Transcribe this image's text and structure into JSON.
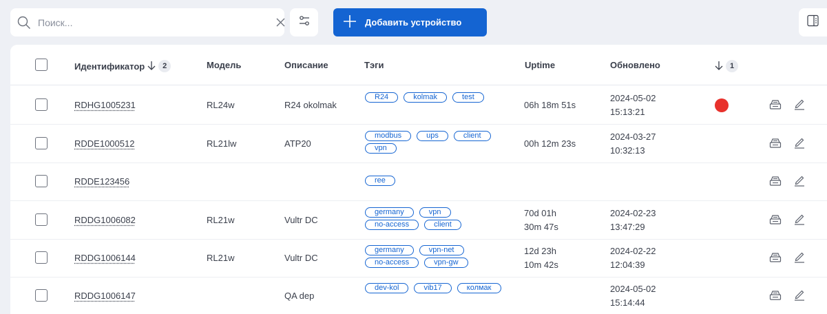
{
  "toolbar": {
    "search_placeholder": "Поиск...",
    "add_label": "Добавить устройство"
  },
  "table": {
    "headers": {
      "id": "Идентификатор",
      "id_sort_index": "2",
      "model": "Модель",
      "description": "Описание",
      "tags": "Тэги",
      "uptime": "Uptime",
      "updated": "Обновлено",
      "status_sort_index": "1"
    },
    "rows": [
      {
        "id": "RDHG1005231",
        "model": "RL24w",
        "description": "R24 okolmak",
        "tags": [
          "R24",
          "kolmak",
          "test"
        ],
        "uptime_1": "06h 18m 51s",
        "uptime_2": "",
        "date": "2024-05-02",
        "time": "15:13:21",
        "status": "error"
      },
      {
        "id": "RDDE1000512",
        "model": "RL21lw",
        "description": "ATP20",
        "tags": [
          "modbus",
          "ups",
          "client",
          "vpn"
        ],
        "uptime_1": "00h 12m 23s",
        "uptime_2": "",
        "date": "2024-03-27",
        "time": "10:32:13",
        "status": ""
      },
      {
        "id": "RDDE123456",
        "model": "",
        "description": "",
        "tags": [
          "ree"
        ],
        "uptime_1": "",
        "uptime_2": "",
        "date": "",
        "time": "",
        "status": ""
      },
      {
        "id": "RDDG1006082",
        "model": "RL21w",
        "description": "Vultr DC",
        "tags": [
          "germany",
          "vpn",
          "no-access",
          "client"
        ],
        "uptime_1": "70d 01h",
        "uptime_2": "30m 47s",
        "date": "2024-02-23",
        "time": "13:47:29",
        "status": ""
      },
      {
        "id": "RDDG1006144",
        "model": "RL21w",
        "description": "Vultr DC",
        "tags": [
          "germany",
          "vpn-net",
          "no-access",
          "vpn-gw"
        ],
        "uptime_1": "12d 23h",
        "uptime_2": "10m 42s",
        "date": "2024-02-22",
        "time": "12:04:39",
        "status": ""
      },
      {
        "id": "RDDG1006147",
        "model": "",
        "description": "QA dep",
        "tags": [
          "dev-kol",
          "vib17",
          "колмак"
        ],
        "uptime_1": "",
        "uptime_2": "",
        "date": "2024-05-02",
        "time": "15:14:44",
        "status": ""
      }
    ]
  },
  "colors": {
    "accent": "#1464d2",
    "status_error": "#e8312c",
    "background": "#eef0f5"
  },
  "icons": {
    "search": "search-icon",
    "clear": "close-icon",
    "filter": "filter-sliders-icon",
    "add": "plus-icon",
    "columns": "columns-panel-icon",
    "sort": "arrow-down-icon",
    "console": "terminal-icon",
    "edit": "pencil-icon"
  }
}
